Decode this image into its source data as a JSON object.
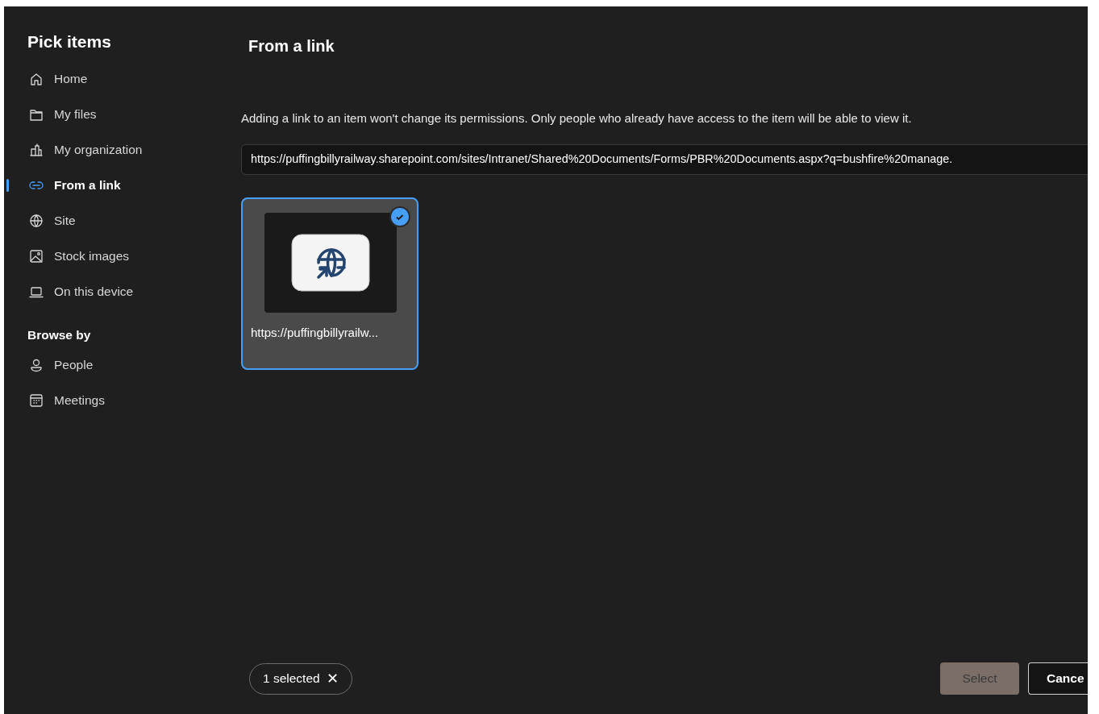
{
  "sidebar": {
    "title": "Pick items",
    "items": [
      {
        "label": "Home",
        "selected": false
      },
      {
        "label": "My files",
        "selected": false
      },
      {
        "label": "My organization",
        "selected": false
      },
      {
        "label": "From a link",
        "selected": true
      },
      {
        "label": "Site",
        "selected": false
      },
      {
        "label": "Stock images",
        "selected": false
      },
      {
        "label": "On this device",
        "selected": false
      }
    ],
    "section_title": "Browse by",
    "browse_items": [
      {
        "label": "People",
        "selected": false
      },
      {
        "label": "Meetings",
        "selected": false
      }
    ]
  },
  "main": {
    "title": "From a link",
    "description": "Adding a link to an item won't change its permissions. Only people who already have access to the item will be able to view it.",
    "url_field": {
      "value": "https://puffingbillyrailway.sharepoint.com/sites/Intranet/Shared%20Documents/Forms/PBR%20Documents.aspx?q=bushfire%20manage."
    },
    "items": [
      {
        "name": "https://puffingbillyrailw...",
        "selected": true
      }
    ]
  },
  "footer": {
    "selection_chip": "1 selected",
    "chip_close": "✕",
    "select_button": {
      "label": "Select",
      "disabled": true
    },
    "cancel_button": "Cance"
  }
}
